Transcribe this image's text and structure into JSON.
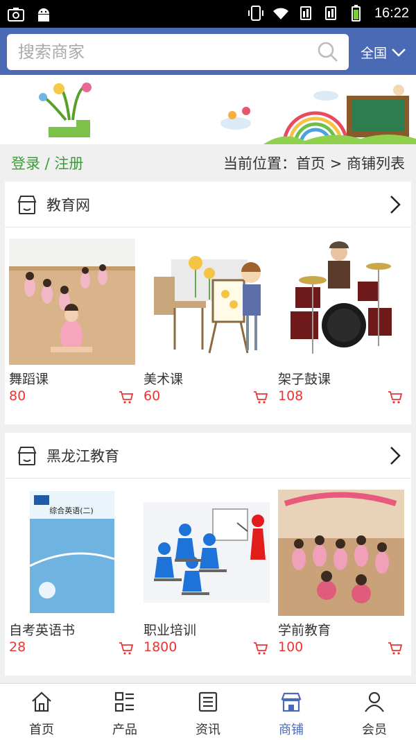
{
  "status_bar": {
    "time": "16:22"
  },
  "search": {
    "placeholder": "搜索商家",
    "region": "全国"
  },
  "nav": {
    "login": "登录 / 注册",
    "breadcrumb": "当前位置：首页 > 商铺列表"
  },
  "shops": [
    {
      "name": "教育网",
      "products": [
        {
          "name": "舞蹈课",
          "price": "80",
          "image": "dance-class-photo"
        },
        {
          "name": "美术课",
          "price": "60",
          "image": "art-class-illustration"
        },
        {
          "name": "架子鼓课",
          "price": "108",
          "image": "drum-kit-photo"
        }
      ]
    },
    {
      "name": "黑龙江教育",
      "products": [
        {
          "name": "自考英语书",
          "price": "28",
          "image": "english-book-cover",
          "cover_title": "综合英语(二)"
        },
        {
          "name": "职业培训",
          "price": "1800",
          "image": "training-3d-figures"
        },
        {
          "name": "学前教育",
          "price": "100",
          "image": "preschool-photo"
        }
      ]
    }
  ],
  "tabs": [
    {
      "label": "首页",
      "icon": "home-icon"
    },
    {
      "label": "产品",
      "icon": "list-icon"
    },
    {
      "label": "资讯",
      "icon": "news-icon"
    },
    {
      "label": "商铺",
      "icon": "shop-icon",
      "active": true
    },
    {
      "label": "会员",
      "icon": "user-icon"
    }
  ],
  "colors": {
    "header": "#4b6ab5",
    "price": "#ee3333",
    "login": "#3a9d3a",
    "active_tab": "#4b6ab5"
  }
}
